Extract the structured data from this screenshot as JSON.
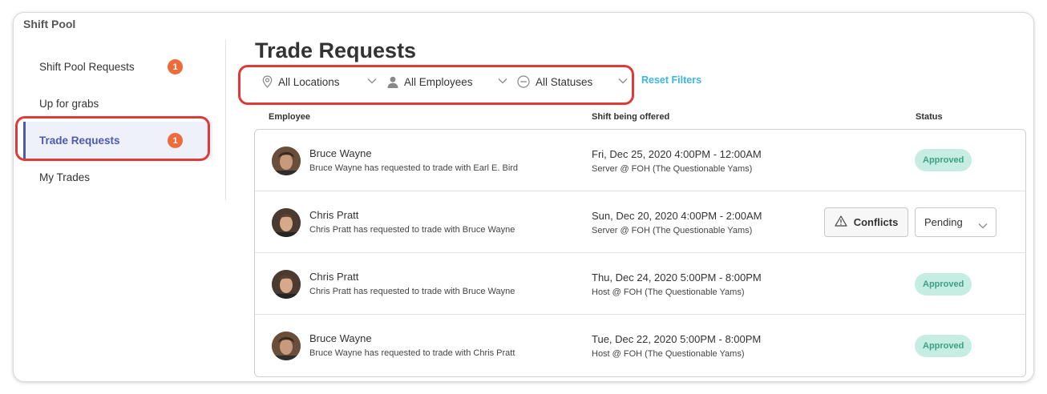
{
  "app": {
    "title": "Shift Pool"
  },
  "sidebar": {
    "items": [
      {
        "label": "Shift Pool Requests",
        "badge": "1"
      },
      {
        "label": "Up for grabs"
      },
      {
        "label": "Trade Requests",
        "badge": "1",
        "active": true
      },
      {
        "label": "My Trades"
      }
    ]
  },
  "page": {
    "title": "Trade Requests"
  },
  "filters": {
    "location": {
      "label": "All Locations",
      "icon": "map-pin-icon"
    },
    "employee": {
      "label": "All Employees",
      "icon": "person-icon"
    },
    "status": {
      "label": "All Statuses",
      "icon": "circle-minus-icon"
    },
    "reset_label": "Reset Filters"
  },
  "table": {
    "headers": {
      "employee": "Employee",
      "shift": "Shift being offered",
      "status": "Status"
    },
    "rows": [
      {
        "name": "Bruce Wayne",
        "detail": "Bruce Wayne has requested to trade with Earl E. Bird",
        "shift_time": "Fri, Dec 25, 2020 4:00PM - 12:00AM",
        "shift_detail": "Server @ FOH (The Questionable Yams)",
        "status": "Approved"
      },
      {
        "name": "Chris Pratt",
        "detail": "Chris Pratt has requested to trade with Bruce Wayne",
        "shift_time": "Sun, Dec 20, 2020 4:00PM - 2:00AM",
        "shift_detail": "Server @ FOH (The Questionable Yams)",
        "conflicts_label": "Conflicts",
        "status": "Pending"
      },
      {
        "name": "Chris Pratt",
        "detail": "Chris Pratt has requested to trade with Bruce Wayne",
        "shift_time": "Thu, Dec 24, 2020 5:00PM - 8:00PM",
        "shift_detail": "Host @ FOH (The Questionable Yams)",
        "status": "Approved"
      },
      {
        "name": "Bruce Wayne",
        "detail": "Bruce Wayne has requested to trade with Chris Pratt",
        "shift_time": "Tue, Dec 22, 2020 5:00PM - 8:00PM",
        "shift_detail": "Host @ FOH (The Questionable Yams)",
        "status": "Approved"
      }
    ]
  },
  "colors": {
    "accent": "#4a5bb0",
    "badge": "#ee6b3b",
    "highlight": "#e03a36",
    "link": "#38b6e5",
    "approved_bg": "#c6ede2",
    "approved_text": "#3c9f84"
  }
}
